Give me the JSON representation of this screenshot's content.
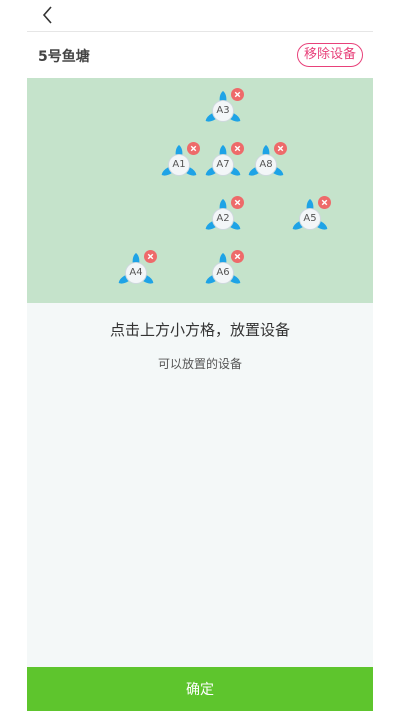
{
  "header": {
    "back_icon": "chevron-left-icon"
  },
  "pond": {
    "title": "5号鱼塘",
    "remove_label": "移除设备"
  },
  "colors": {
    "grid_bg": "#c5e3cb",
    "device_blue": "#1ea3e6",
    "delete_red": "#ee6a6a",
    "accent_pink": "#e8417a",
    "confirm_green": "#5ec52d"
  },
  "devices": [
    {
      "label": "A3"
    },
    {
      "label": "A1"
    },
    {
      "label": "A7"
    },
    {
      "label": "A8"
    },
    {
      "label": "A2"
    },
    {
      "label": "A5"
    },
    {
      "label": "A4"
    },
    {
      "label": "A6"
    }
  ],
  "panel": {
    "hint_main": "点击上方小方格，放置设备",
    "hint_sub": "可以放置的设备"
  },
  "footer": {
    "confirm_label": "确定"
  }
}
